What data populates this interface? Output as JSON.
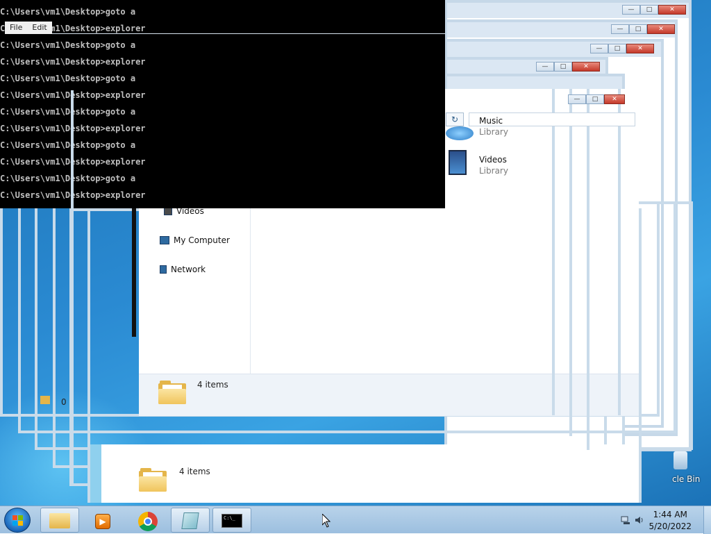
{
  "console": {
    "lines": [
      "C:\\Users\\vm1\\Desktop>goto a",
      "C:\\Users\\vm1\\Desktop>explorer",
      "C:\\Users\\vm1\\Desktop>goto a",
      "C:\\Users\\vm1\\Desktop>explorer",
      "C:\\Users\\vm1\\Desktop>goto a",
      "C:\\Users\\vm1\\Desktop>explorer",
      "C:\\Users\\vm1\\Desktop>goto a",
      "C:\\Users\\vm1\\Desktop>explorer",
      "C:\\Users\\vm1\\Desktop>goto a",
      "C:\\Users\\vm1\\Desktop>explorer",
      "C:\\Users\\vm1\\Desktop>goto a",
      "C:\\Users\\vm1\\Desktop>explorer"
    ]
  },
  "menu": {
    "file": "File",
    "edit": "Edit"
  },
  "explorer": {
    "nav": {
      "videos": "Videos",
      "my_computer": "My Computer",
      "network": "Network"
    },
    "libraries": [
      {
        "title": "Music",
        "subtitle": "Library"
      },
      {
        "title": "Videos",
        "subtitle": "Library"
      }
    ],
    "status_items_main": "4 items",
    "status_items_lower": "4 items",
    "status_zero": "0"
  },
  "desktop": {
    "recycle_bin_label": "cle Bin"
  },
  "window_controls": {
    "minimize": "—",
    "maximize": "□",
    "close": "✕"
  },
  "taskbar": {
    "clock_time": "1:44 AM",
    "clock_date": "5/20/2022",
    "cmd_icon_text": "C:\\_"
  }
}
